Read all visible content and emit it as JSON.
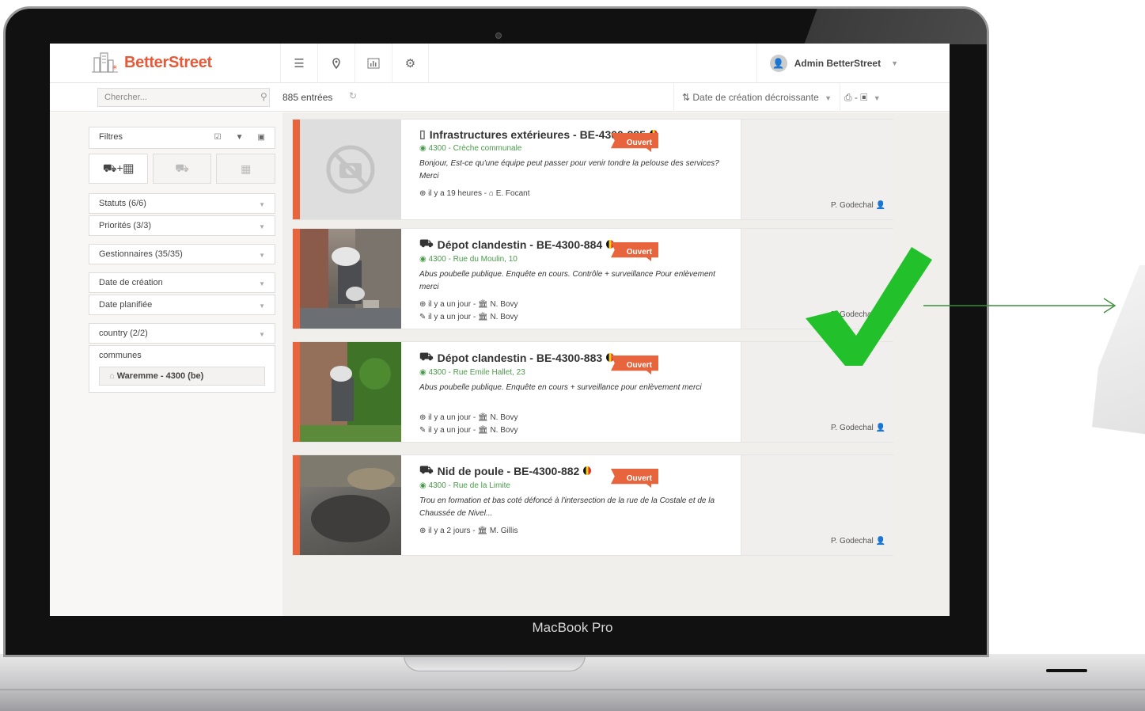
{
  "device": {
    "label": "MacBook Pro"
  },
  "app": {
    "logo_text": "BetterStreet"
  },
  "nav": {
    "icons": [
      "list-icon",
      "map-pin-icon",
      "chart-icon",
      "gear-icon"
    ]
  },
  "user": {
    "name": "Admin BetterStreet"
  },
  "toolbar": {
    "search_placeholder": "Chercher...",
    "count": "885 entrées",
    "sort": "Date de création décroissante",
    "print": "⎙ - ▣"
  },
  "filters": {
    "heading": "Filtres",
    "type_buttons": [
      "⛟+▦",
      "⛟",
      "▦"
    ],
    "rows": [
      "Statuts (6/6)",
      "Priorités (3/3)",
      "Gestionnaires (35/35)",
      "Date de création",
      "Date planifiée",
      "country (2/2)"
    ],
    "communes_label": "communes",
    "commune_chip": "Waremme - 4300 (be)"
  },
  "issues": [
    {
      "title": "Infrastructures extérieures - BE-4300-885",
      "title_icon": "building-icon",
      "address": "4300 - Crèche communale",
      "description": "Bonjour, Est-ce qu'une équipe peut passer pour venir tondre la pelouse des services? Merci",
      "meta1": "il y a 19 heures - ⌂ E. Focant",
      "meta2": "",
      "status": "Ouvert",
      "owner": "P. Godechal",
      "has_photo": false
    },
    {
      "title": "Dépot clandestin - BE-4300-884",
      "title_icon": "road-icon",
      "address": "4300 - Rue du Moulin, 10",
      "description": "Abus poubelle publique. Enquête en cours. Contrôle + surveillance Pour enlèvement merci",
      "meta1": "il y a un jour - 🏛 N. Bovy",
      "meta2": "il y a un jour - 🏛 N. Bovy",
      "status": "Ouvert",
      "owner": "P. Godechal",
      "has_photo": true
    },
    {
      "title": "Dépot clandestin - BE-4300-883",
      "title_icon": "road-icon",
      "address": "4300 - Rue Emile Hallet, 23",
      "description": "Abus poubelle publique. Enquête en cours + surveillance pour enlèvement merci",
      "meta1": "il y a un jour - 🏛 N. Bovy",
      "meta2": "il y a un jour - 🏛 N. Bovy",
      "status": "Ouvert",
      "owner": "P. Godechal",
      "has_photo": true
    },
    {
      "title": "Nid de poule - BE-4300-882",
      "title_icon": "road-icon",
      "address": "4300 - Rue de la Limite",
      "description": "Trou en formation et bas coté défoncé à l'intersection de la rue de la Costale et de la Chaussée de Nivel...",
      "meta1": "il y a 2 jours - 🏛 M. Gillis",
      "meta2": "",
      "status": "Ouvert",
      "owner": "P. Godechal",
      "has_photo": true
    }
  ],
  "colors": {
    "brand": "#e55a3a",
    "status_open": "#e8643c",
    "checkmark": "#22c02a",
    "arrow": "#3a8c3a"
  }
}
